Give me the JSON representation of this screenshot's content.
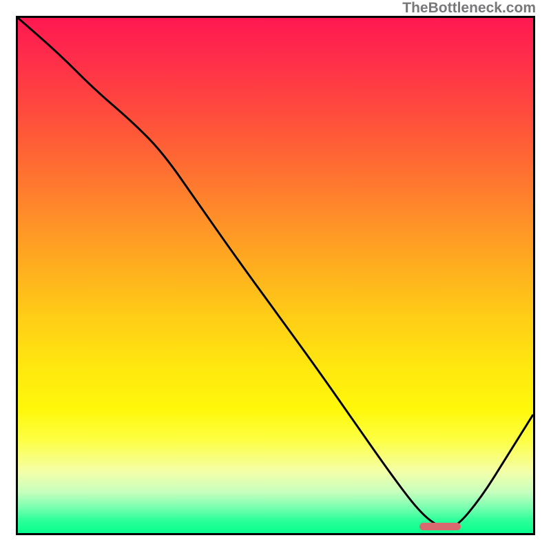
{
  "watermark": "TheBottleneck.com",
  "colors": {
    "frame": "#000000",
    "curve": "#000000",
    "marker": "#d86a6f"
  },
  "chart_data": {
    "type": "line",
    "title": "",
    "xlabel": "",
    "ylabel": "",
    "xlim": [
      0,
      100
    ],
    "ylim": [
      0,
      100
    ],
    "grid": false,
    "series": [
      {
        "name": "bottleneck-curve",
        "x": [
          0,
          8,
          15,
          22,
          28,
          35,
          42,
          50,
          58,
          65,
          72,
          78,
          82,
          85,
          90,
          95,
          100
        ],
        "values": [
          100,
          93,
          86,
          80,
          74,
          64,
          54,
          43,
          32,
          22,
          12,
          4,
          1,
          1,
          7,
          15,
          23
        ]
      }
    ],
    "marker": {
      "x_start": 78,
      "x_end": 86,
      "y": 0
    },
    "annotations": []
  }
}
